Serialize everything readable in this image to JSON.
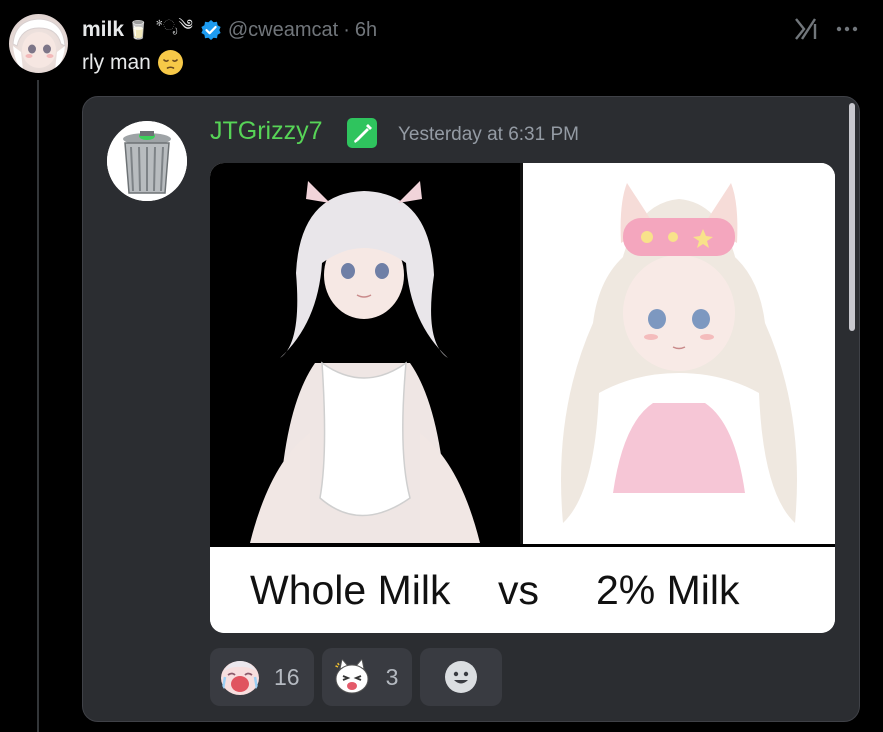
{
  "tweet": {
    "display_name": "milk",
    "name_emoji": "🥛",
    "name_deco": "*ೃ༄",
    "handle": "@cweamcat",
    "separator": "·",
    "time": "6h",
    "text": "rly man"
  },
  "discord_message": {
    "username": "JTGrizzy7",
    "timestamp": "Yesterday at 6:31 PM",
    "image_caption": {
      "left": "Whole Milk",
      "vs": "vs",
      "right": "2% Milk"
    },
    "reactions": [
      {
        "icon": "crying-laugh-emoji",
        "count": "16"
      },
      {
        "icon": "cat-laugh-emoji",
        "count": "3"
      }
    ]
  },
  "icons": {
    "verified": "verified-badge-icon",
    "grok": "grok-icon",
    "more": "more-options-icon",
    "add_reaction": "add-reaction-icon",
    "role": "role-badge-icon"
  },
  "colors": {
    "background": "#000000",
    "verified": "#1d9bf0",
    "discord_username": "#57d457",
    "card": "#2b2d31"
  }
}
